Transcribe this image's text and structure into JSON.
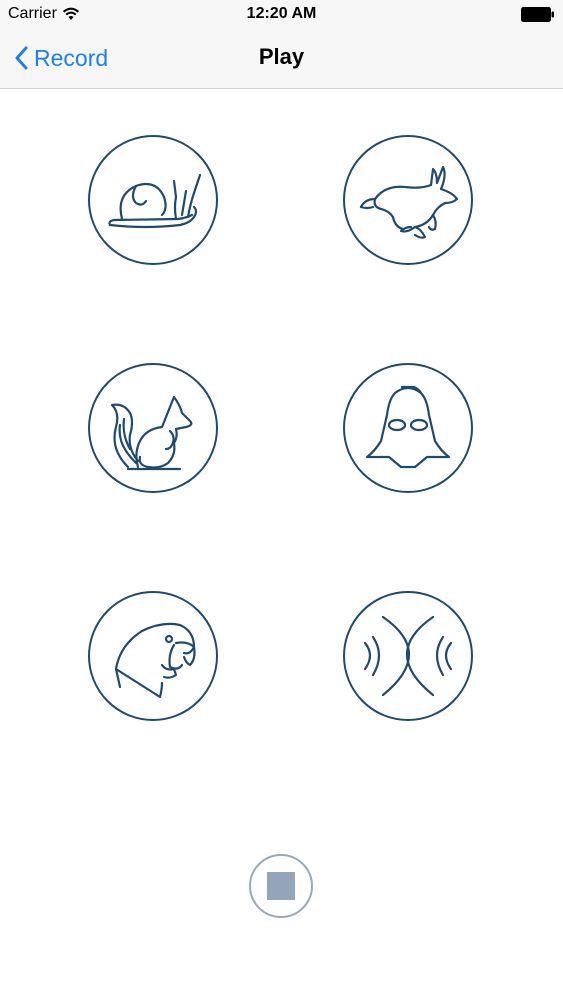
{
  "status_bar": {
    "carrier": "Carrier",
    "time": "12:20 AM"
  },
  "nav_bar": {
    "back_label": "Record",
    "title": "Play"
  },
  "effects": [
    {
      "icon": "snail-icon"
    },
    {
      "icon": "rabbit-icon"
    },
    {
      "icon": "squirrel-icon"
    },
    {
      "icon": "darth-vader-helmet-icon"
    },
    {
      "icon": "parrot-icon"
    },
    {
      "icon": "reverb-waves-icon"
    }
  ],
  "stop_button": {
    "icon": "stop-icon"
  },
  "colors": {
    "accent": "#1f7ef6",
    "icon_stroke": "#1f4a70",
    "stop": "#93a5b9",
    "nav_background": "#f7f7f7"
  }
}
